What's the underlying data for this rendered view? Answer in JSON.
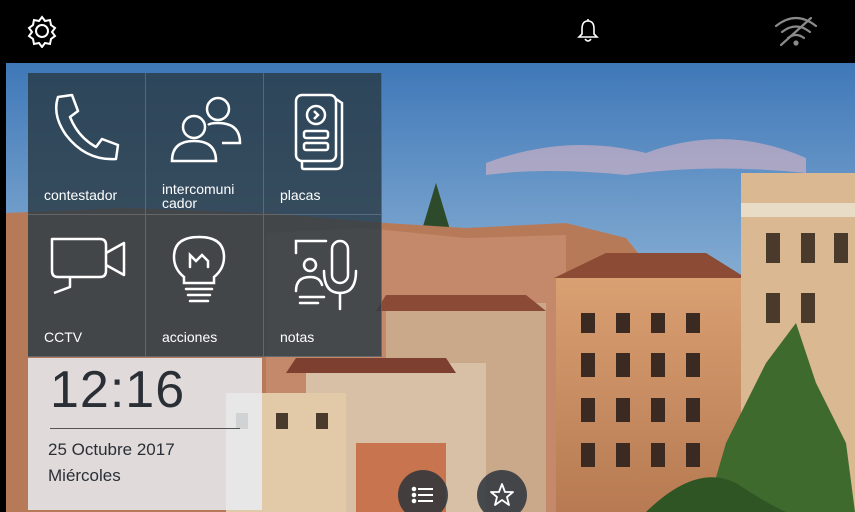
{
  "topbar": {
    "settings_icon": "gear-icon",
    "notification_icon": "bell-icon",
    "wifi_icon": "wifi-off-icon"
  },
  "tiles": [
    {
      "id": "contestador",
      "label": "contestador",
      "icon": "phone-icon"
    },
    {
      "id": "intercomunicador",
      "label": "intercomuni\ncador",
      "icon": "users-icon"
    },
    {
      "id": "placas",
      "label": "placas",
      "icon": "door-panel-icon"
    },
    {
      "id": "cctv",
      "label": "CCTV",
      "icon": "camera-icon"
    },
    {
      "id": "acciones",
      "label": "acciones",
      "icon": "lightbulb-icon"
    },
    {
      "id": "notas",
      "label": "notas",
      "icon": "voice-note-icon"
    }
  ],
  "clock": {
    "time": "12:16",
    "date": "25 Octubre 2017",
    "day": "Miércoles"
  },
  "fabs": {
    "menu_icon": "menu-list-icon",
    "favorites_icon": "star-icon"
  },
  "colors": {
    "tile_bg": "#2a3a46",
    "topbar_bg": "#000000",
    "clock_bg": "#e6ebf0"
  }
}
